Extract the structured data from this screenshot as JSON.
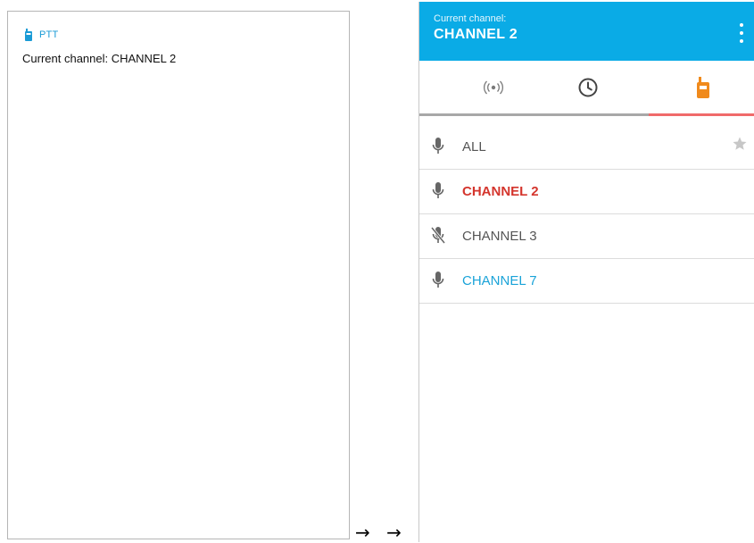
{
  "notification": {
    "app_name": "PTT",
    "text": "Current channel: CHANNEL 2"
  },
  "arrows": "→ →",
  "app": {
    "header": {
      "caption": "Current channel:",
      "channel": "CHANNEL 2",
      "menu_icon": "more-vert-icon",
      "background_color": "#0aabe6"
    },
    "tabs": [
      {
        "icon": "broadcast-icon",
        "selected": false
      },
      {
        "icon": "history-clock-icon",
        "selected": false
      },
      {
        "icon": "walkie-talkie-icon",
        "selected": true
      }
    ],
    "channels": [
      {
        "label": "ALL",
        "icon": "mic-icon",
        "starred": false,
        "state": "normal"
      },
      {
        "label": "CHANNEL 2",
        "icon": "mic-icon",
        "state": "active"
      },
      {
        "label": "CHANNEL 3",
        "icon": "mic-off-icon",
        "state": "muted"
      },
      {
        "label": "CHANNEL 7",
        "icon": "mic-icon",
        "state": "monitored"
      }
    ],
    "colors": {
      "active_channel": "#d4352d",
      "monitored_channel": "#1aa3d8",
      "selected_tab_icon": "#f08a1c",
      "tab_underline": "#f06a6a"
    }
  }
}
